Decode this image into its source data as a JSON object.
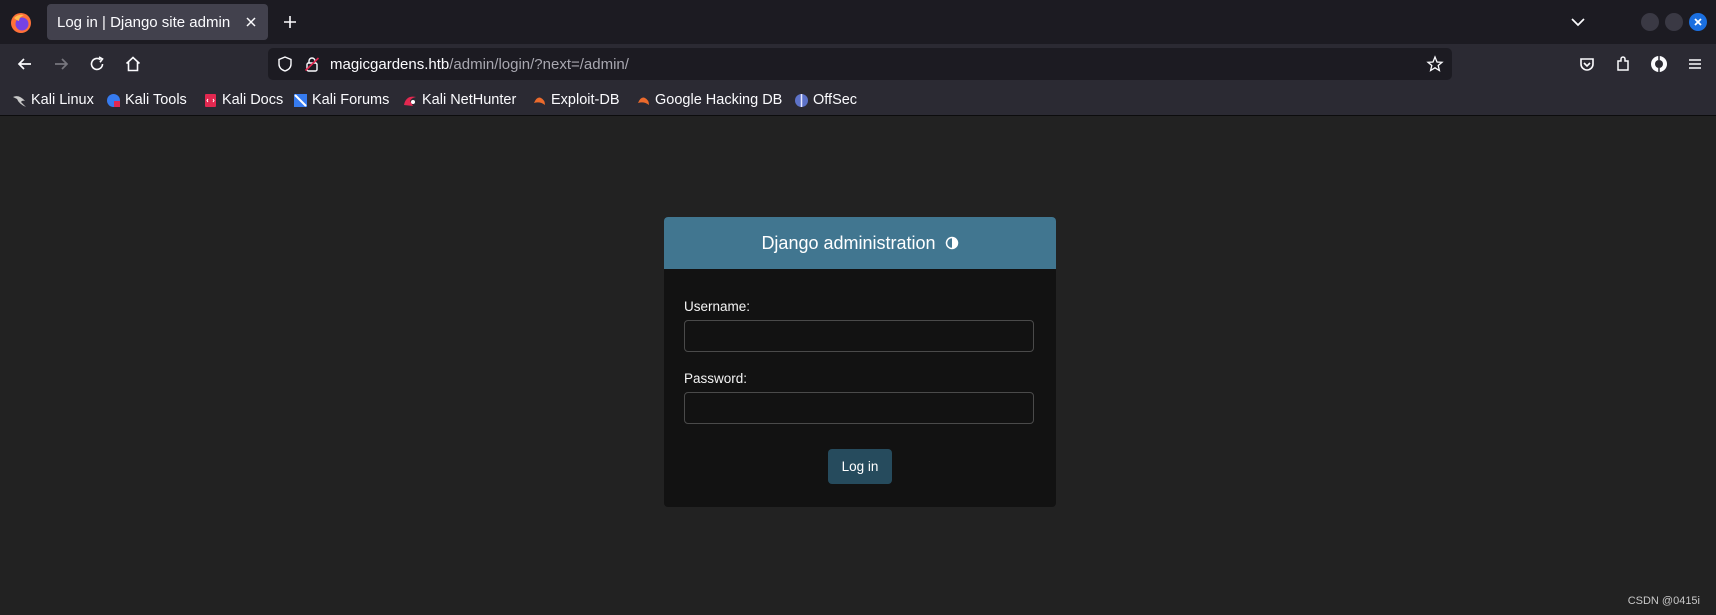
{
  "browser": {
    "tab_title": "Log in | Django site admin",
    "url_host": "magicgardens.htb",
    "url_path": "/admin/login/?next=/admin/"
  },
  "bookmarks": [
    {
      "label": "Kali Linux",
      "icon": "kali-dragon-icon"
    },
    {
      "label": "Kali Tools",
      "icon": "kali-tools-icon"
    },
    {
      "label": "Kali Docs",
      "icon": "kali-docs-icon"
    },
    {
      "label": "Kali Forums",
      "icon": "kali-forums-icon"
    },
    {
      "label": "Kali NetHunter",
      "icon": "kali-nethunter-icon"
    },
    {
      "label": "Exploit-DB",
      "icon": "exploit-db-icon"
    },
    {
      "label": "Google Hacking DB",
      "icon": "google-hacking-db-icon"
    },
    {
      "label": "OffSec",
      "icon": "offsec-icon"
    }
  ],
  "login": {
    "site_title": "Django administration",
    "username_label": "Username:",
    "username_value": "",
    "password_label": "Password:",
    "password_value": "",
    "submit_label": "Log in"
  },
  "watermark": "CSDN @0415i",
  "colors": {
    "header_bg": "#417690",
    "button_bg": "#264b5d",
    "page_bg": "#222222",
    "card_bg": "#121212"
  }
}
